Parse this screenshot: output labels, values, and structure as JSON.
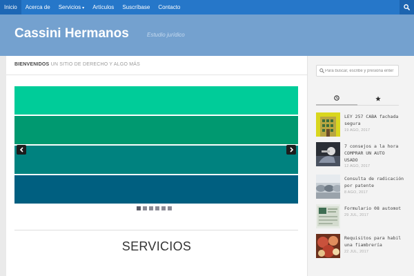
{
  "nav": {
    "items": [
      "Inicio",
      "Acerca de",
      "Servicios",
      "Artículos",
      "Suscríbase",
      "Contacto"
    ],
    "services_caret": "▾",
    "active": "Inicio"
  },
  "header": {
    "title": "Cassini Hermanos",
    "tagline": "Estudio jurídico"
  },
  "main": {
    "welcome_strong": "BIENVENIDOS",
    "welcome_rest": "UN SITIO DE DERECHO Y ALGO MÁS",
    "slider": {
      "stripe_colors": [
        "#00cc99",
        "#009970",
        "#00827f",
        "#005f80"
      ],
      "dot_count": 6,
      "active_dot": 1
    },
    "section_heading": "SERVICIOS"
  },
  "sidebar": {
    "search_placeholder": "Para buscar, escribe y presiona enter",
    "tabs": [
      "clock-icon",
      "star-icon"
    ],
    "posts": [
      {
        "title_lines": [
          "LEY 257 CABA fachada",
          "segura"
        ],
        "date": "19 AGO, 2017",
        "thumb": "building"
      },
      {
        "title_lines": [
          "7 consejos a la hora",
          "COMPRAR UN AUTO",
          "USADO"
        ],
        "date": "12 AGO, 2017",
        "thumb": "car-keys"
      },
      {
        "title_lines": [
          "Consulta de radicación",
          "por patente"
        ],
        "date": "8 AGO, 2017",
        "thumb": "cars-row"
      },
      {
        "title_lines": [
          "Formulario 08 automot"
        ],
        "date": "29 JUL, 2017",
        "thumb": "form-08"
      },
      {
        "title_lines": [
          "Requisitos para habil",
          "una fiambrería"
        ],
        "date": "22 JUL, 2017",
        "thumb": "deli"
      }
    ]
  },
  "colors": {
    "nav_bg": "#2677c9",
    "header_bg": "#74a1cf",
    "page_bg": "#eaeaea"
  }
}
